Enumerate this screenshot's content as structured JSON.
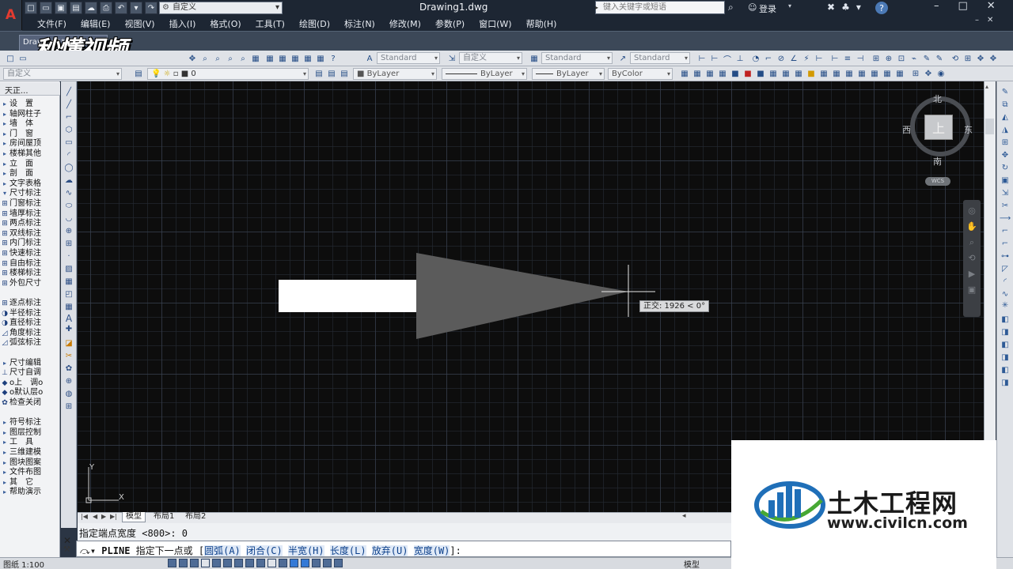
{
  "titlebar": {
    "workspace": "自定义",
    "document_title": "Drawing1.dwg",
    "search_placeholder": "键入关键字或短语",
    "login_label": "登录",
    "help_label": "?",
    "app_logo": "A"
  },
  "menu": [
    "文件(F)",
    "编辑(E)",
    "视图(V)",
    "插入(I)",
    "格式(O)",
    "工具(T)",
    "绘图(D)",
    "标注(N)",
    "修改(M)",
    "参数(P)",
    "窗口(W)",
    "帮助(H)"
  ],
  "tabs": {
    "document_tab": "Drawing1*",
    "watermark_text": "秒懂视频"
  },
  "toolbar": {
    "text_style": "Standard",
    "dim_style": "自定义",
    "table_style": "Standard",
    "multileader_style": "Standard",
    "workspace2": "自定义",
    "layer_current": "0",
    "color": "ByLayer",
    "linetype": "ByLayer",
    "lineweight": "ByLayer",
    "plotstyle": "ByColor"
  },
  "palette": {
    "title": "天正...",
    "items": [
      {
        "icon": "▸",
        "label": "设　置"
      },
      {
        "icon": "▸",
        "label": "轴网柱子"
      },
      {
        "icon": "▸",
        "label": "墙　体"
      },
      {
        "icon": "▸",
        "label": "门　窗"
      },
      {
        "icon": "▸",
        "label": "房间屋顶"
      },
      {
        "icon": "▸",
        "label": "楼梯其他"
      },
      {
        "icon": "▸",
        "label": "立　面"
      },
      {
        "icon": "▸",
        "label": "剖　面"
      },
      {
        "icon": "▸",
        "label": "文字表格"
      },
      {
        "icon": "▾",
        "label": "尺寸标注"
      },
      {
        "icon": "⊞",
        "label": "门窗标注"
      },
      {
        "icon": "⊞",
        "label": "墙厚标注"
      },
      {
        "icon": "⊞",
        "label": "两点标注"
      },
      {
        "icon": "⊞",
        "label": "双线标注"
      },
      {
        "icon": "⊞",
        "label": "内门标注"
      },
      {
        "icon": "⊞",
        "label": "快速标注"
      },
      {
        "icon": "⊞",
        "label": "自由标注"
      },
      {
        "icon": "⊞",
        "label": "楼梯标注"
      },
      {
        "icon": "⊞",
        "label": "外包尺寸"
      },
      {
        "icon": "",
        "label": ""
      },
      {
        "icon": "⊞",
        "label": "逐点标注"
      },
      {
        "icon": "◑",
        "label": "半径标注"
      },
      {
        "icon": "◑",
        "label": "直径标注"
      },
      {
        "icon": "◿",
        "label": "角度标注"
      },
      {
        "icon": "◿",
        "label": "弧弦标注"
      },
      {
        "icon": "",
        "label": ""
      },
      {
        "icon": "▸",
        "label": "尺寸编辑"
      },
      {
        "icon": "⊥",
        "label": "尺寸自调"
      },
      {
        "icon": "◆",
        "label": "o上　调o"
      },
      {
        "icon": "◆",
        "label": "o默认层o"
      },
      {
        "icon": "✿",
        "label": "检查关闭"
      },
      {
        "icon": "",
        "label": ""
      },
      {
        "icon": "▸",
        "label": "符号标注"
      },
      {
        "icon": "▸",
        "label": "图层控制"
      },
      {
        "icon": "▸",
        "label": "工　具"
      },
      {
        "icon": "▸",
        "label": "三维建模"
      },
      {
        "icon": "▸",
        "label": "图块图案"
      },
      {
        "icon": "▸",
        "label": "文件布图"
      },
      {
        "icon": "▸",
        "label": "其　它"
      },
      {
        "icon": "▸",
        "label": "帮助演示"
      }
    ]
  },
  "canvas": {
    "tooltip": "正交: 1926 < 0°",
    "ucs_x": "X",
    "ucs_y": "Y"
  },
  "viewcube": {
    "north": "北",
    "south": "南",
    "east": "东",
    "west": "西",
    "face": "上",
    "wcs": "WCS"
  },
  "layout_tabs": [
    "模型",
    "布局1",
    "布局2"
  ],
  "command": {
    "history": "指定端点宽度 <800>: 0",
    "prompt_cmd": "PLINE",
    "prompt_text": "指定下一点或 [",
    "options": [
      {
        "label": "圆弧(A)",
        "sep": " "
      },
      {
        "label": "闭合(C)",
        "sep": " "
      },
      {
        "label": "半宽(H)",
        "sep": " "
      },
      {
        "label": "长度(L)",
        "sep": " "
      },
      {
        "label": "放弃(U)",
        "sep": " "
      },
      {
        "label": "宽度(W)",
        "sep": ""
      }
    ],
    "prompt_end": "]:"
  },
  "status": {
    "scale": "图纸 1:100",
    "model": "模型"
  },
  "brand": {
    "name": "土木工程网",
    "url": "www.civilcn.com"
  },
  "colors": {
    "canvas_bg": "#0d0d0d",
    "shaft_fill": "#ffffff",
    "arrow_fill": "#5b5b5b",
    "brand_blue": "#1f6fb8",
    "brand_green": "#47a834"
  }
}
